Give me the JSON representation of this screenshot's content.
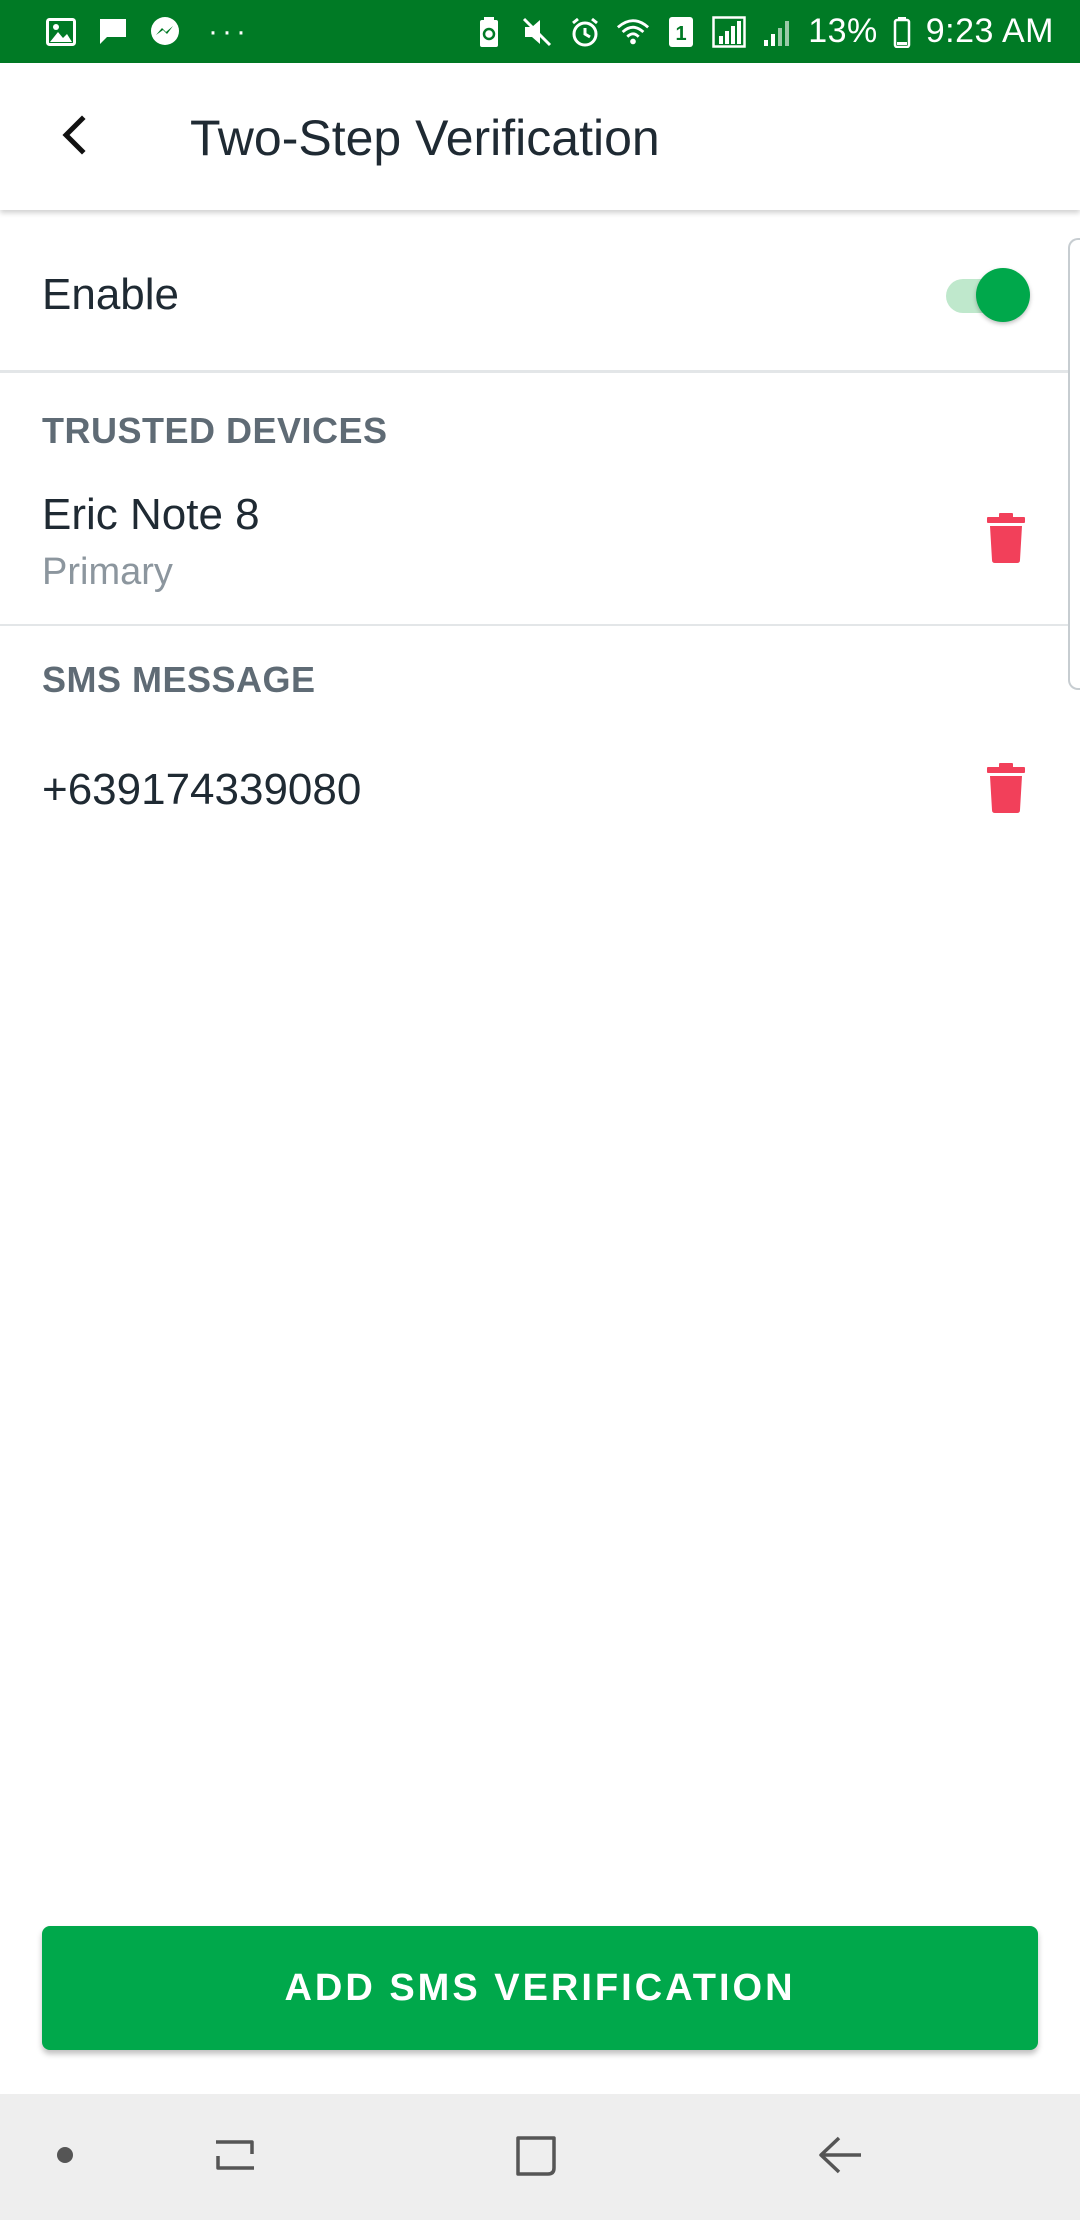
{
  "status_bar": {
    "battery_percent": "13%",
    "time": "9:23 AM",
    "sim_slot": "1",
    "more": "···",
    "background_color": "#007a25",
    "left_icons": [
      "image-icon",
      "message-icon",
      "messenger-icon"
    ],
    "right_icons": [
      "battery-saver-icon",
      "mute-icon",
      "alarm-icon",
      "wifi-icon",
      "sim-icon",
      "signal-icon",
      "signal-icon",
      "battery-icon"
    ]
  },
  "header": {
    "title": "Two-Step Verification",
    "back_icon": "chevron-left-icon"
  },
  "settings": {
    "enable_label": "Enable",
    "enable_on": true,
    "toggle_color": "#00a84b"
  },
  "trusted_devices": {
    "header": "TRUSTED DEVICES",
    "items": [
      {
        "name": "Eric Note 8",
        "subtitle": "Primary",
        "action_icon": "trash-icon"
      }
    ]
  },
  "sms_message": {
    "header": "SMS MESSAGE",
    "items": [
      {
        "number": "+639174339080",
        "action_icon": "trash-icon"
      }
    ]
  },
  "actions": {
    "add_sms_label": "ADD SMS VERIFICATION",
    "button_color": "#00a84b",
    "delete_color": "#f2405a"
  },
  "nav_bar": {
    "icons": [
      "dot-icon",
      "recents-icon",
      "home-icon",
      "back-icon"
    ]
  }
}
